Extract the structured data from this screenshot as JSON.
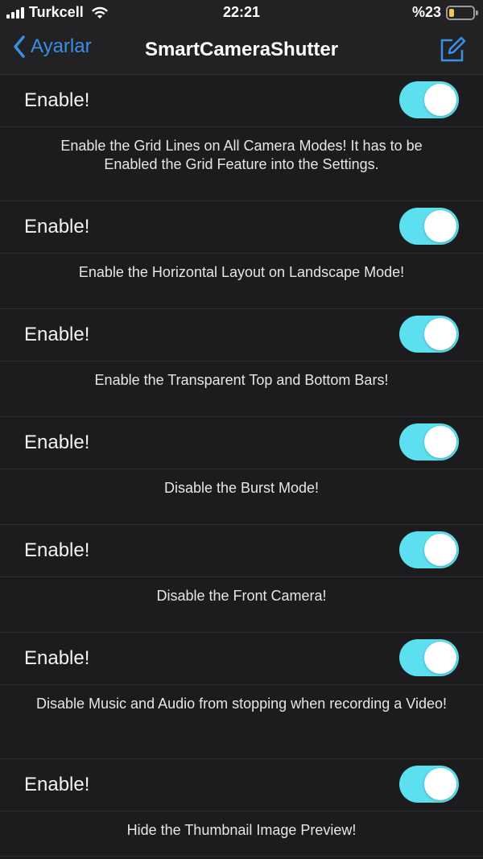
{
  "status_bar": {
    "carrier": "Turkcell",
    "time": "22:21",
    "battery_text": "%23",
    "battery_level": 0.23
  },
  "nav": {
    "back_label": "Ayarlar",
    "title": "SmartCameraShutter"
  },
  "colors": {
    "accent": "#3a8fe4",
    "toggle_on": "#5ce0f0",
    "background": "#1c1c1e"
  },
  "settings": [
    {
      "label": "Enable!",
      "on": true,
      "description": "Enable the Grid Lines on All Camera Modes! It has to be Enabled the Grid Feature into the Settings."
    },
    {
      "label": "Enable!",
      "on": true,
      "description": "Enable the Horizontal Layout on Landscape Mode!"
    },
    {
      "label": "Enable!",
      "on": true,
      "description": "Enable the Transparent Top and Bottom Bars!"
    },
    {
      "label": "Enable!",
      "on": true,
      "description": "Disable the Burst Mode!"
    },
    {
      "label": "Enable!",
      "on": true,
      "description": "Disable the Front Camera!"
    },
    {
      "label": "Enable!",
      "on": true,
      "description": "Disable Music and Audio from stopping when recording a Video!"
    },
    {
      "label": "Enable!",
      "on": true,
      "description": "Hide the Thumbnail Image Preview!"
    }
  ]
}
